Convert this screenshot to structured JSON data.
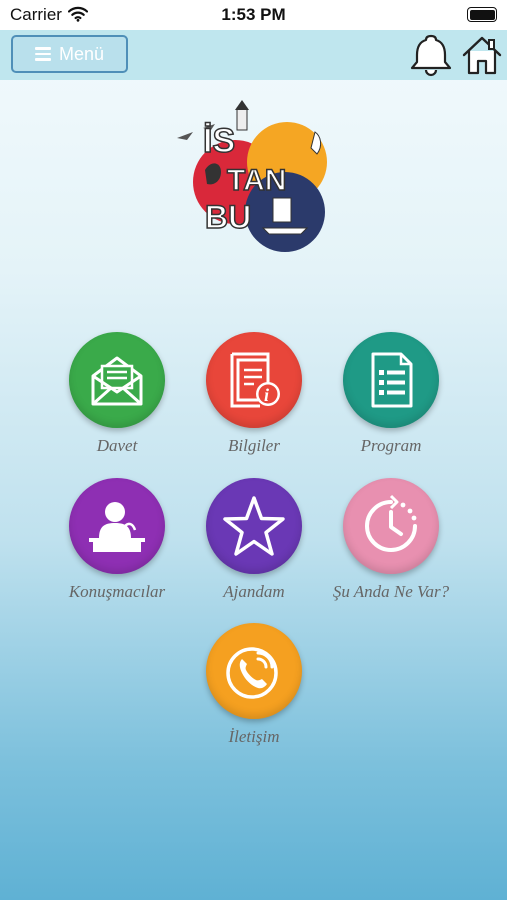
{
  "status_bar": {
    "carrier": "Carrier",
    "time": "1:53 PM"
  },
  "navbar": {
    "menu_label": "Menü",
    "bell_icon": "bell-icon",
    "home_icon": "home-icon"
  },
  "logo": {
    "letters": [
      "İS",
      "TAN",
      "BU"
    ]
  },
  "tiles": [
    {
      "label": "Davet",
      "icon": "envelope-icon",
      "color": "#3aaa4a"
    },
    {
      "label": "Bilgiler",
      "icon": "info-document-icon",
      "color": "#e8463a"
    },
    {
      "label": "Program",
      "icon": "checklist-icon",
      "color": "#1f9a86"
    },
    {
      "label": "Konuşmacılar",
      "icon": "speaker-podium-icon",
      "color": "#8e2fb3"
    },
    {
      "label": "Ajandam",
      "icon": "star-icon",
      "color": "#6a38b5"
    },
    {
      "label": "Şu Anda Ne Var?",
      "icon": "clock-icon",
      "color": "#e890b0"
    },
    {
      "label": "İletişim",
      "icon": "phone-icon",
      "color": "#f5a020"
    }
  ]
}
